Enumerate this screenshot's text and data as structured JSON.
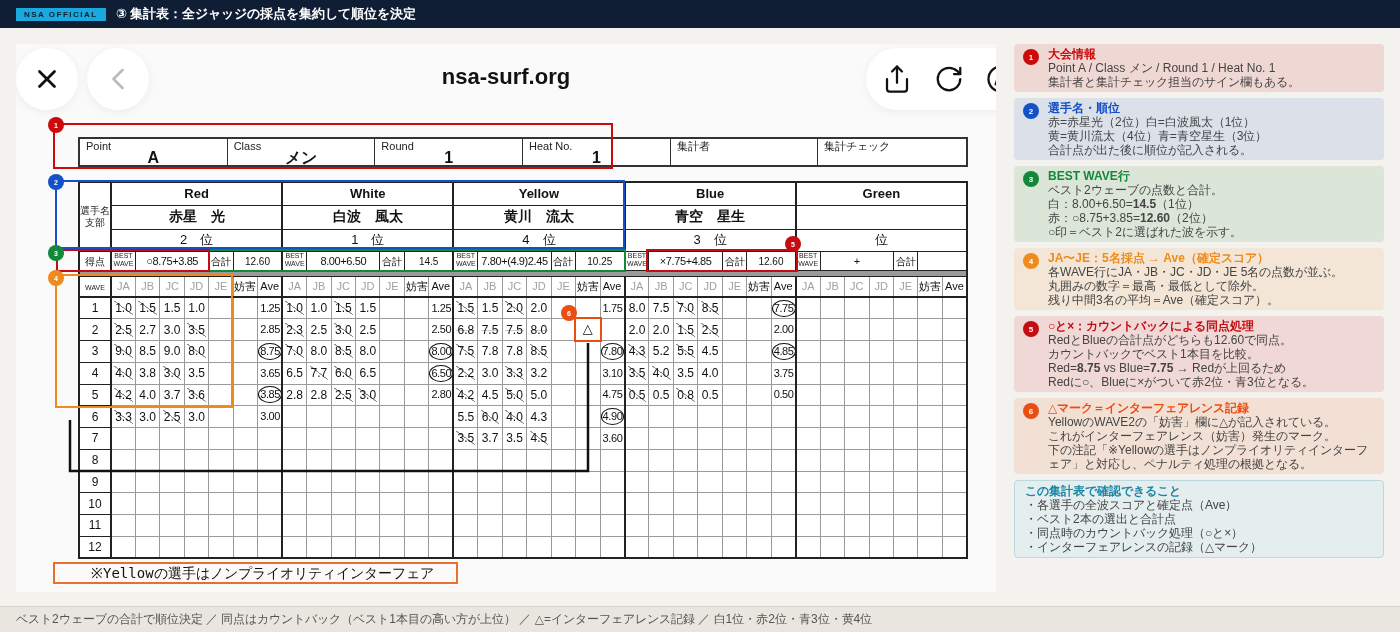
{
  "top_bar": {
    "badge": "NSA OFFICIAL",
    "title": "③ 集計表：全ジャッジの採点を集約して順位を決定"
  },
  "browser": {
    "url": "nsa-surf.org"
  },
  "sheet": {
    "header_fields": [
      {
        "label": "Point",
        "value": "A"
      },
      {
        "label": "Class",
        "value": "メン"
      },
      {
        "label": "Round",
        "value": "1"
      },
      {
        "label": "Heat No.",
        "value": "1"
      },
      {
        "label": "集計者"
      },
      {
        "label": "集計チェック"
      }
    ],
    "player_label": "選手名支部",
    "score_label": "得点",
    "wave_label": "WAVE",
    "wave_numbers": [
      "1",
      "2",
      "3",
      "4",
      "5",
      "6",
      "7",
      "8",
      "9",
      "10",
      "11",
      "12"
    ],
    "surfers": [
      {
        "color_label": "Red",
        "name": "赤星　光",
        "rank": "2　位",
        "best_label": "BEST WAVE",
        "best": "○8.75+3.85",
        "total_label": "合計",
        "total": "12.60",
        "columns": [
          "JA",
          "JB",
          "JC",
          "JD",
          "JE",
          "妨害",
          "Ave"
        ],
        "waves": [
          {
            "scores": [
              {
                "v": "1.0",
                "struck": true
              },
              {
                "v": "1.5",
                "struck": true
              },
              {
                "v": "1.5",
                "struck": false
              },
              {
                "v": "1.0",
                "struck": false
              }
            ],
            "ave": "1.25",
            "circled": false,
            "crossed_out": false
          },
          {
            "scores": [
              {
                "v": "2.5",
                "struck": true
              },
              {
                "v": "2.7",
                "struck": false
              },
              {
                "v": "3.0",
                "struck": false
              },
              {
                "v": "3.5",
                "struck": true
              }
            ],
            "ave": "2.85",
            "circled": false,
            "crossed_out": false
          },
          {
            "scores": [
              {
                "v": "9.0",
                "struck": true
              },
              {
                "v": "8.5",
                "struck": false
              },
              {
                "v": "9.0",
                "struck": false
              },
              {
                "v": "8.0",
                "struck": true
              }
            ],
            "ave": "8.75",
            "circled": true,
            "crossed_out": false
          },
          {
            "scores": [
              {
                "v": "4.0",
                "struck": true
              },
              {
                "v": "3.8",
                "struck": false
              },
              {
                "v": "3.0",
                "struck": true
              },
              {
                "v": "3.5",
                "struck": false
              }
            ],
            "ave": "3.65",
            "circled": false,
            "crossed_out": false
          },
          {
            "scores": [
              {
                "v": "4.2",
                "struck": true
              },
              {
                "v": "4.0",
                "struck": false
              },
              {
                "v": "3.7",
                "struck": false
              },
              {
                "v": "3.6",
                "struck": true
              }
            ],
            "ave": "3.85",
            "circled": true,
            "crossed_out": false
          },
          {
            "scores": [
              {
                "v": "3.3",
                "struck": true
              },
              {
                "v": "3.0",
                "struck": false
              },
              {
                "v": "2.5",
                "struck": true
              },
              {
                "v": "3.0",
                "struck": false
              }
            ],
            "ave": "3.00",
            "circled": false,
            "crossed_out": false
          }
        ]
      },
      {
        "color_label": "White",
        "name": "白波　風太",
        "rank": "1　位",
        "best_label": "BEST WAVE",
        "best": "8.00+6.50",
        "total_label": "合計",
        "total": "14.5",
        "columns": [
          "JA",
          "JB",
          "JC",
          "JD",
          "JE",
          "妨害",
          "Ave"
        ],
        "waves": [
          {
            "scores": [
              {
                "v": "1.0",
                "struck": true
              },
              {
                "v": "1.0",
                "struck": false
              },
              {
                "v": "1.5",
                "struck": true
              },
              {
                "v": "1.5",
                "struck": false
              }
            ],
            "ave": "1.25",
            "circled": false,
            "crossed_out": false
          },
          {
            "scores": [
              {
                "v": "2.3",
                "struck": true
              },
              {
                "v": "2.5",
                "struck": false
              },
              {
                "v": "3.0",
                "struck": true
              },
              {
                "v": "2.5",
                "struck": false
              }
            ],
            "ave": "2.50",
            "circled": false,
            "crossed_out": false
          },
          {
            "scores": [
              {
                "v": "7.0",
                "struck": true
              },
              {
                "v": "8.0",
                "struck": false
              },
              {
                "v": "8.5",
                "struck": true
              },
              {
                "v": "8.0",
                "struck": false
              }
            ],
            "ave": "8.00",
            "circled": true,
            "crossed_out": false
          },
          {
            "scores": [
              {
                "v": "6.5",
                "struck": false
              },
              {
                "v": "7.7",
                "struck": true
              },
              {
                "v": "6.0",
                "struck": true
              },
              {
                "v": "6.5",
                "struck": false
              }
            ],
            "ave": "6.50",
            "circled": true,
            "crossed_out": false
          },
          {
            "scores": [
              {
                "v": "2.8",
                "struck": false
              },
              {
                "v": "2.8",
                "struck": false
              },
              {
                "v": "2.5",
                "struck": true
              },
              {
                "v": "3.0",
                "struck": true
              }
            ],
            "ave": "2.80",
            "circled": false,
            "crossed_out": false
          }
        ]
      },
      {
        "color_label": "Yellow",
        "name": "黄川　流太",
        "rank": "4　位",
        "best_label": "BEST WAVE",
        "best": "7.80+(4.9)2.45",
        "total_label": "合計",
        "total": "10.25",
        "columns": [
          "JA",
          "JB",
          "JC",
          "JD",
          "JE",
          "妨害",
          "Ave"
        ],
        "waves": [
          {
            "scores": [
              {
                "v": "1.5",
                "struck": true
              },
              {
                "v": "1.5",
                "struck": false
              },
              {
                "v": "2.0",
                "struck": true
              },
              {
                "v": "2.0",
                "struck": false
              }
            ],
            "ave": "1.75",
            "circled": false,
            "crossed_out": false
          },
          {
            "scores": [
              {
                "v": "6.8",
                "struck": false
              },
              {
                "v": "7.5",
                "struck": false
              },
              {
                "v": "7.5",
                "struck": false
              },
              {
                "v": "8.0",
                "struck": false
              }
            ],
            "interference": "△",
            "crossed_out": true
          },
          {
            "scores": [
              {
                "v": "7.5",
                "struck": true
              },
              {
                "v": "7.8",
                "struck": false
              },
              {
                "v": "7.8",
                "struck": false
              },
              {
                "v": "8.5",
                "struck": true
              }
            ],
            "ave": "7.80",
            "circled": true,
            "crossed_out": false
          },
          {
            "scores": [
              {
                "v": "2.2",
                "struck": true
              },
              {
                "v": "3.0",
                "struck": false
              },
              {
                "v": "3.3",
                "struck": true
              },
              {
                "v": "3.2",
                "struck": false
              }
            ],
            "ave": "3.10",
            "circled": false,
            "crossed_out": false
          },
          {
            "scores": [
              {
                "v": "4.2",
                "struck": true
              },
              {
                "v": "4.5",
                "struck": false
              },
              {
                "v": "5.0",
                "struck": true
              },
              {
                "v": "5.0",
                "struck": false
              }
            ],
            "ave": "4.75",
            "circled": false,
            "crossed_out": false
          },
          {
            "scores": [
              {
                "v": "5.5",
                "struck": false
              },
              {
                "v": "6.0",
                "struck": true
              },
              {
                "v": "4.0",
                "struck": true
              },
              {
                "v": "4.3",
                "struck": false
              }
            ],
            "ave": "4.90",
            "circled": true,
            "crossed_out": false
          },
          {
            "scores": [
              {
                "v": "3.5",
                "struck": true
              },
              {
                "v": "3.7",
                "struck": false
              },
              {
                "v": "3.5",
                "struck": false
              },
              {
                "v": "4.5",
                "struck": true
              }
            ],
            "ave": "3.60",
            "circled": false,
            "crossed_out": false
          }
        ]
      },
      {
        "color_label": "Blue",
        "name": "青空　星生",
        "rank": "3　位",
        "best_label": "BEST WAVE",
        "best": "×7.75+4.85",
        "total_label": "合計",
        "total": "12.60",
        "columns": [
          "JA",
          "JB",
          "JC",
          "JD",
          "JE",
          "妨害",
          "Ave"
        ],
        "waves": [
          {
            "scores": [
              {
                "v": "8.0",
                "struck": false
              },
              {
                "v": "7.5",
                "struck": false
              },
              {
                "v": "7.0",
                "struck": true
              },
              {
                "v": "8.5",
                "struck": true
              }
            ],
            "ave": "7.75",
            "circled": true,
            "crossed_out": false
          },
          {
            "scores": [
              {
                "v": "2.0",
                "struck": false
              },
              {
                "v": "2.0",
                "struck": false
              },
              {
                "v": "1.5",
                "struck": true
              },
              {
                "v": "2.5",
                "struck": true
              }
            ],
            "ave": "2.00",
            "circled": false,
            "crossed_out": false
          },
          {
            "scores": [
              {
                "v": "4.3",
                "struck": true
              },
              {
                "v": "5.2",
                "struck": false
              },
              {
                "v": "5.5",
                "struck": true
              },
              {
                "v": "4.5",
                "struck": false
              }
            ],
            "ave": "4.85",
            "circled": true,
            "crossed_out": false
          },
          {
            "scores": [
              {
                "v": "3.5",
                "struck": true
              },
              {
                "v": "4.0",
                "struck": true
              },
              {
                "v": "3.5",
                "struck": false
              },
              {
                "v": "4.0",
                "struck": false
              }
            ],
            "ave": "3.75",
            "circled": false,
            "crossed_out": false
          },
          {
            "scores": [
              {
                "v": "0.5",
                "struck": true
              },
              {
                "v": "0.5",
                "struck": false
              },
              {
                "v": "0.8",
                "struck": true
              },
              {
                "v": "0.5",
                "struck": false
              }
            ],
            "ave": "0.50",
            "circled": false,
            "crossed_out": false
          }
        ]
      },
      {
        "color_label": "Green",
        "rank": "位",
        "best_label": "BEST WAVE",
        "best": "+",
        "total_label": "合計",
        "columns": [
          "JA",
          "JB",
          "JC",
          "JD",
          "JE",
          "妨害",
          "Ave"
        ]
      }
    ],
    "note": "※Yellowの選手はノンプライオリティインターフェア"
  },
  "annotations": [
    {
      "number": "1",
      "color": "#cc0a0a"
    },
    {
      "number": "2",
      "color": "#1450c8"
    },
    {
      "number": "3",
      "color": "#14883a"
    },
    {
      "number": "4",
      "color": "#f08a1c"
    },
    {
      "number": "5",
      "color": "#c40c12"
    },
    {
      "number": "6",
      "color": "#ea4e12"
    }
  ],
  "cards": [
    {
      "number": "1",
      "color": "#cc0a0a",
      "title": "大会情報",
      "lines": [
        "Point A / Class メン / Round 1 / Heat No. 1",
        "集計者と集計チェック担当のサイン欄もある。"
      ]
    },
    {
      "number": "2",
      "color": "#1450c8",
      "title": "選手名・順位",
      "lines": [
        "赤=赤星光（2位）白=白波風太（1位）",
        "黄=黄川流太（4位）青=青空星生（3位）",
        "合計点が出た後に順位が記入される。"
      ]
    },
    {
      "number": "3",
      "color": "#14883a",
      "title": "BEST WAVE行",
      "lines": [
        "ベスト2ウェーブの点数と合計。",
        "白：8.00+6.50=**14.5**（1位）",
        "赤：○8.75+3.85=**12.60**（2位）",
        "○印＝ベスト2に選ばれた波を示す。"
      ]
    },
    {
      "number": "4",
      "color": "#f08a1c",
      "title": "JA〜JE：5名採点 → Ave（確定スコア）",
      "lines": [
        "各WAVE行にJA・JB・JC・JD・JE 5名の点数が並ぶ。",
        "丸囲みの数字＝最高・最低として除外。",
        "残り中間3名の平均＝Ave（確定スコア）。"
      ]
    },
    {
      "number": "5",
      "color": "#c40c12",
      "title": "○と×：カウントバックによる同点処理",
      "lines": [
        "RedとBlueの合計点がどちらも12.60で同点。",
        "カウントバックでベスト1本目を比較。",
        "Red=**8.75** vs Blue=**7.75** → Redが上回るため",
        "Redに○、Blueに×がついて赤2位・青3位となる。"
      ]
    },
    {
      "number": "6",
      "color": "#ea4e12",
      "title": "△マーク＝インターフェアレンス記録",
      "lines": [
        "YellowのWAVE2の「妨害」欄に△が記入されている。",
        "これがインターフェアレンス（妨害）発生のマーク。",
        "下の注記「※Yellowの選手はノンプライオリティインターフェア」と対応し、ペナルティ処理の根拠となる。"
      ]
    }
  ],
  "summary": {
    "title": "この集計表で確認できること",
    "lines": [
      "・各選手の全波スコアと確定点（Ave）",
      "・ベスト2本の選出と合計点",
      "・同点時のカウントバック処理（○と×）",
      "・インターフェアレンスの記録（△マーク）"
    ]
  },
  "footer": "ベスト2ウェーブの合計で順位決定 ／ 同点はカウントバック（ベスト1本目の高い方が上位） ／ △=インターフェアレンス記録 ／ 白1位・赤2位・青3位・黄4位"
}
